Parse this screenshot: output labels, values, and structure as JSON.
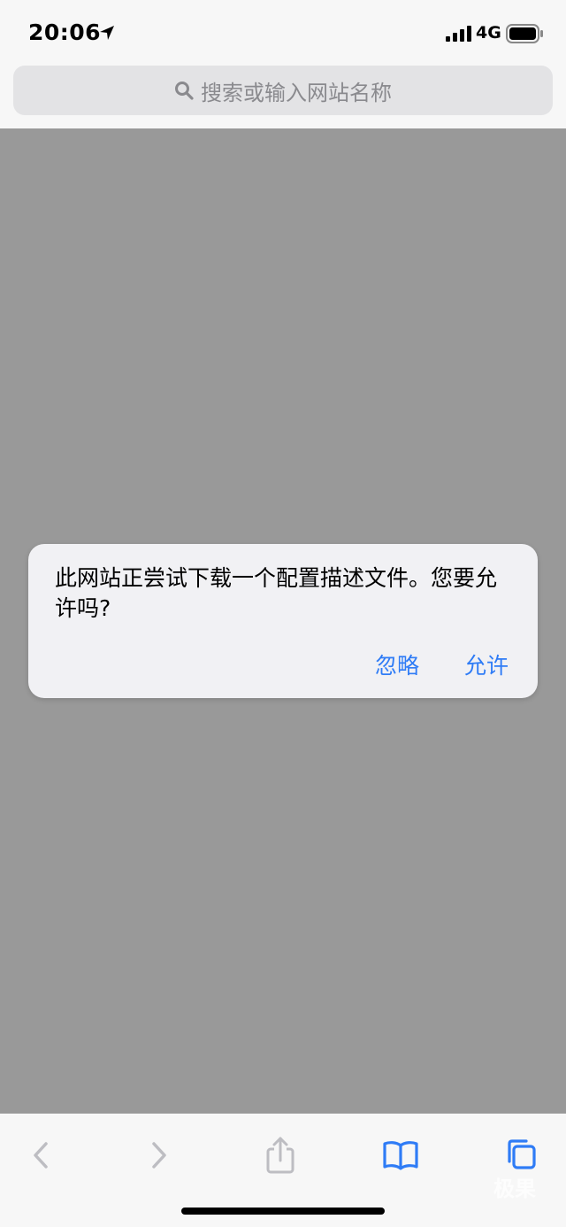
{
  "status_bar": {
    "time": "20:06",
    "network": "4G",
    "location_icon": "location-arrow-icon",
    "signal_icon": "cellular-signal-icon",
    "battery_icon": "battery-icon"
  },
  "address_bar": {
    "placeholder": "搜索或输入网站名称",
    "icon": "search-icon"
  },
  "alert": {
    "message": "此网站正尝试下载一个配置描述文件。您要允许吗?",
    "ignore_label": "忽略",
    "allow_label": "允许",
    "button_color": "#2f7cf6"
  },
  "toolbar": {
    "icons": [
      "back-chevron-icon",
      "forward-chevron-icon",
      "share-icon",
      "bookmarks-icon",
      "tabs-icon"
    ],
    "active_color": "#2f7cf6",
    "disabled_color": "#bdbdc2"
  },
  "watermark": "极果",
  "colors": {
    "page_background": "#999999",
    "chrome_background": "#f7f7f7"
  }
}
